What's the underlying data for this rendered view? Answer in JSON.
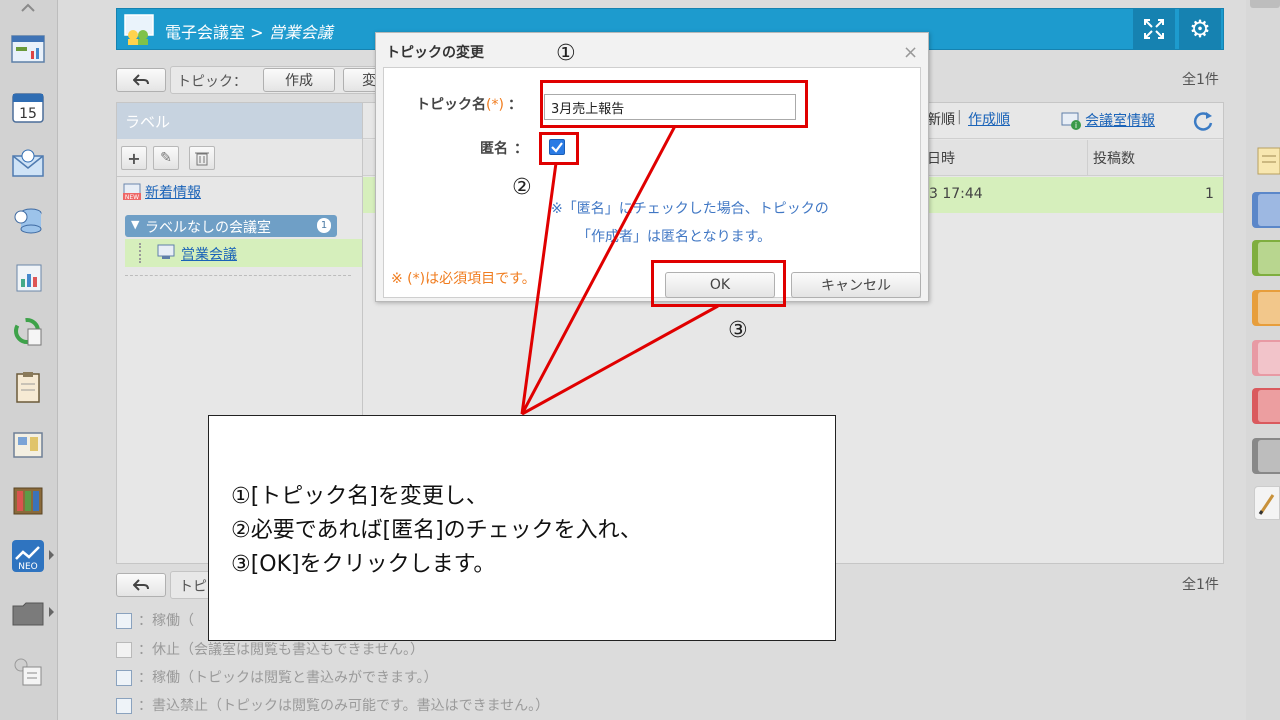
{
  "header": {
    "title_room": "電子会議室",
    "title_sep": " > ",
    "title_topic": "営業会議"
  },
  "toolbar": {
    "topic_label": "トピック：",
    "create": "作成",
    "change_partial": "変",
    "count": "全1件"
  },
  "toolbar_bottom": {
    "topic_partial": "トピ",
    "count": "全1件"
  },
  "label_panel": {
    "heading": "ラベル",
    "new_info": "新着情報",
    "group_label": "ラベルなしの会議室",
    "group_badge": "1",
    "room": "営業会議"
  },
  "main": {
    "sort_partial": "新順",
    "sort_sep": "|",
    "sort_created": "作成順",
    "room_info": "会議室情報",
    "col_date_partial": "日時",
    "col_posts": "投稿数",
    "row_date_partial": "3 17:44",
    "row_posts": "1"
  },
  "dialog": {
    "title": "トピックの変更",
    "topic_label": "トピック名",
    "required_mark": "(*)",
    "colon": "：",
    "topic_value": "3月売上報告",
    "anon_label": "匿名",
    "anon_checked": true,
    "anon_note_1": "※「匿名」にチェックした場合、トピックの",
    "anon_note_2": "「作成者」は匿名となります。",
    "required_note": "※ (*)は必須項目です。",
    "ok": "OK",
    "cancel": "キャンセル",
    "close": "×"
  },
  "legend": [
    "：稼働（",
    "：休止（会議室は閲覧も書込もできません。）",
    "：稼働（トピックは閲覧と書込みができます。）",
    "：書込禁止（トピックは閲覧のみ可能です。書込はできません。）"
  ],
  "annotation": {
    "mark1": "①",
    "mark2": "②",
    "mark3": "③",
    "line1": "①[トピック名]を変更し、",
    "line2": "②必要であれば[匿名]のチェックを入れ、",
    "line3": "③[OK]をクリックします。"
  },
  "colors": {
    "header": "#1d9bce",
    "annotation_red": "#e00000",
    "required": "#f07c1e",
    "row_highlight": "#d6efbc"
  },
  "calendar_day": "15"
}
